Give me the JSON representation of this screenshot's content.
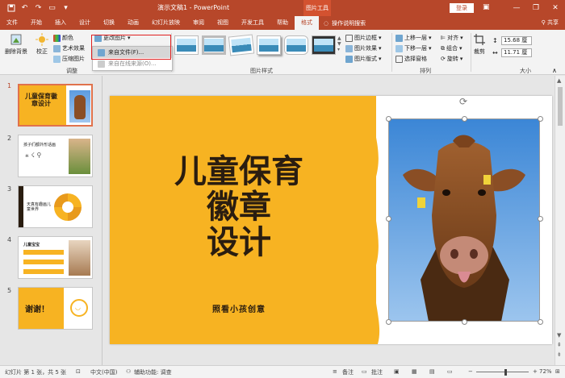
{
  "titlebar": {
    "title": "演示文稿1  -  PowerPoint",
    "contextual": "图片工具",
    "login": "登录",
    "minimize": "—",
    "restore": "❐",
    "close": "✕"
  },
  "tabs": {
    "items": [
      "文件",
      "开始",
      "插入",
      "设计",
      "切换",
      "动画",
      "幻灯片放映",
      "审阅",
      "视图",
      "开发工具",
      "帮助",
      "格式"
    ],
    "active": "格式",
    "tellme": "操作说明搜索",
    "share": "共享"
  },
  "ribbon": {
    "remove_bg": "删除背景",
    "correct": "校正",
    "color": "颜色",
    "artistic": "艺术效果",
    "compress": "压缩图片",
    "change_picture": "更改图片",
    "adjust_label": "调整",
    "styles_label": "图片样式",
    "border": "图片边框",
    "effects": "图片效果",
    "layout": "图片版式",
    "bring_forward": "上移一层",
    "send_backward": "下移一层",
    "selection_pane": "选择窗格",
    "align": "对齐",
    "group": "组合",
    "rotate": "旋转",
    "arrange_label": "排列",
    "crop": "裁剪",
    "height": "15.68 厘",
    "width": "11.71 厘",
    "size_label": "大小"
  },
  "dropdown": {
    "items": [
      "来自文件(F)...",
      "来自在线来源(O)..."
    ]
  },
  "slides": {
    "numbers": [
      "1",
      "2",
      "3",
      "4",
      "5"
    ],
    "thumb1_title": "儿童保育徽章设计",
    "thumb2_title": "孩子们都外形话画",
    "thumb3_title": "天真有趣画儿童世界",
    "thumb4_title": "儿童宝宝",
    "thumb5_title": "谢谢！"
  },
  "slide": {
    "title_line1": "儿童保育",
    "title_line2": "徽章",
    "title_line3": "设计",
    "subtitle": "照看小孩创意"
  },
  "status": {
    "slide_info": "幻灯片 第 1 张，共 5 张",
    "language": "中文(中国)",
    "accessibility": "辅助功能: 调查",
    "notes": "备注",
    "comments": "批注",
    "zoom": "72%"
  },
  "colors": {
    "accent": "#b7472a",
    "slide_yellow": "#f7b322",
    "slide_text": "#2a1d10",
    "highlight_red": "#e02020"
  }
}
